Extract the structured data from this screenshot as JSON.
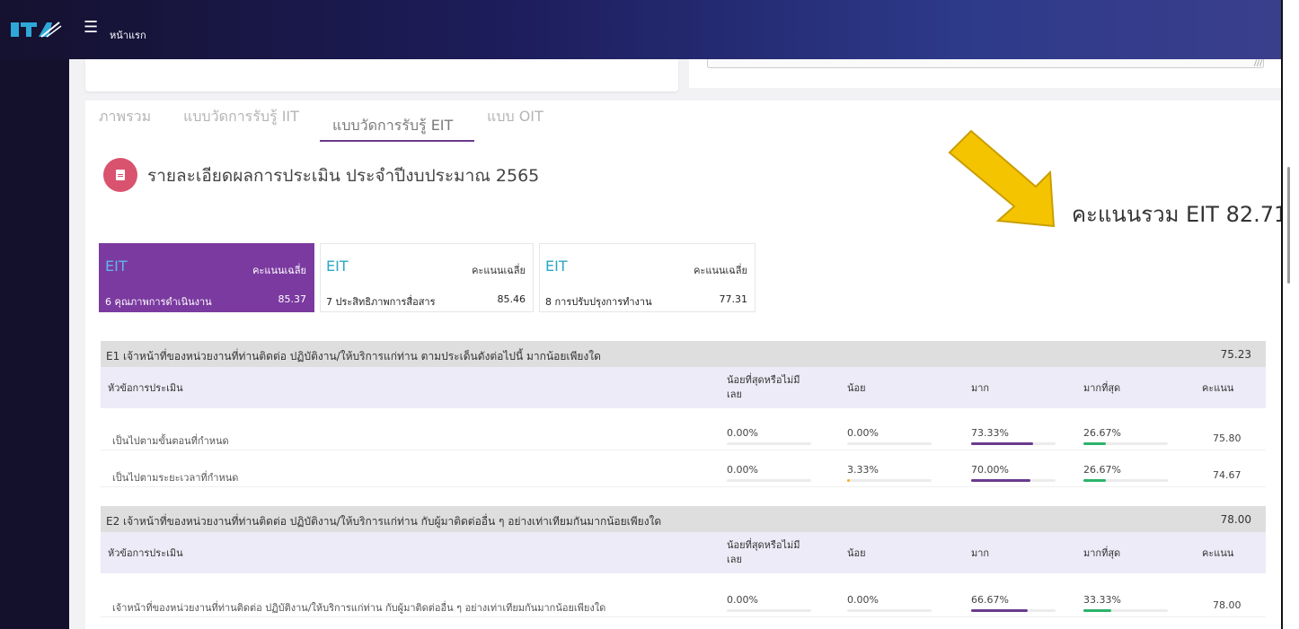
{
  "header": {
    "breadcrumb": "หน้าแรก"
  },
  "tabs": [
    {
      "label": "ภาพรวม",
      "active": false
    },
    {
      "label": "แบบวัดการรับรู้ IIT",
      "active": false
    },
    {
      "label": "แบบวัดการรับรู้ EIT",
      "active": true
    },
    {
      "label": "แบบ OIT",
      "active": false
    }
  ],
  "section_title": "รายละเอียดผลการประเมิน ประจำปีงบประมาณ 2565",
  "total_score": "คะแนนรวม EIT 82.71",
  "cards": [
    {
      "tag": "EIT",
      "avg_label": "คะแนนเฉลี่ย",
      "name": "6 คุณภาพการดำเนินงาน",
      "score": "85.37",
      "active": true
    },
    {
      "tag": "EIT",
      "avg_label": "คะแนนเฉลี่ย",
      "name": "7 ประสิทธิภาพการสื่อสาร",
      "score": "85.46",
      "active": false
    },
    {
      "tag": "EIT",
      "avg_label": "คะแนนเฉลี่ย",
      "name": "8 การปรับปรุงการทำงาน",
      "score": "77.31",
      "active": false
    }
  ],
  "columns": [
    "หัวข้อการประเมิน",
    "น้อยที่สุดหรือไม่มี",
    "เลย",
    "น้อย",
    "มาก",
    "มากที่สุด",
    "คะแนน"
  ],
  "questions": [
    {
      "title": "E1 เจ้าหน้าที่ของหน่วยงานที่ท่านติดต่อ ปฏิบัติงาน/ให้บริการแก่ท่าน ตามประเด็นดังต่อไปนี้ มากน้อยเพียงใด",
      "score": "75.23",
      "rows": [
        {
          "label": "เป็นไปตามขั้นตอนที่กำหนด",
          "least": "0.00%",
          "little": "0.00%",
          "much": "73.33%",
          "most": "26.67%",
          "least_v": 0,
          "little_v": 0,
          "much_v": 73.33,
          "most_v": 26.67,
          "score": "75.80"
        },
        {
          "label": "เป็นไปตามระยะเวลาที่กำหนด",
          "least": "0.00%",
          "little": "3.33%",
          "much": "70.00%",
          "most": "26.67%",
          "least_v": 0,
          "little_v": 3.33,
          "much_v": 70.0,
          "most_v": 26.67,
          "score": "74.67"
        }
      ]
    },
    {
      "title": "E2 เจ้าหน้าที่ของหน่วยงานที่ท่านติดต่อ ปฏิบัติงาน/ให้บริการแก่ท่าน กับผู้มาติดต่ออื่น ๆ อย่างเท่าเทียมกันมากน้อยเพียงใด",
      "score": "78.00",
      "rows": [
        {
          "label": "เจ้าหน้าที่ของหน่วยงานที่ท่านติดต่อ ปฏิบัติงาน/ให้บริการแก่ท่าน กับผู้มาติดต่ออื่น ๆ อย่างเท่าเทียมกันมากน้อยเพียงใด",
          "least": "0.00%",
          "little": "0.00%",
          "much": "66.67%",
          "most": "33.33%",
          "least_v": 0,
          "little_v": 0,
          "much_v": 66.67,
          "most_v": 33.33,
          "score": "78.00"
        }
      ]
    }
  ],
  "colors": {
    "active_card": "#7b3aa0",
    "much_bar": "#6a3a8c",
    "most_bar": "#2cb36b",
    "little_bar": "#f2b51c",
    "arrow": "#f5c400"
  }
}
